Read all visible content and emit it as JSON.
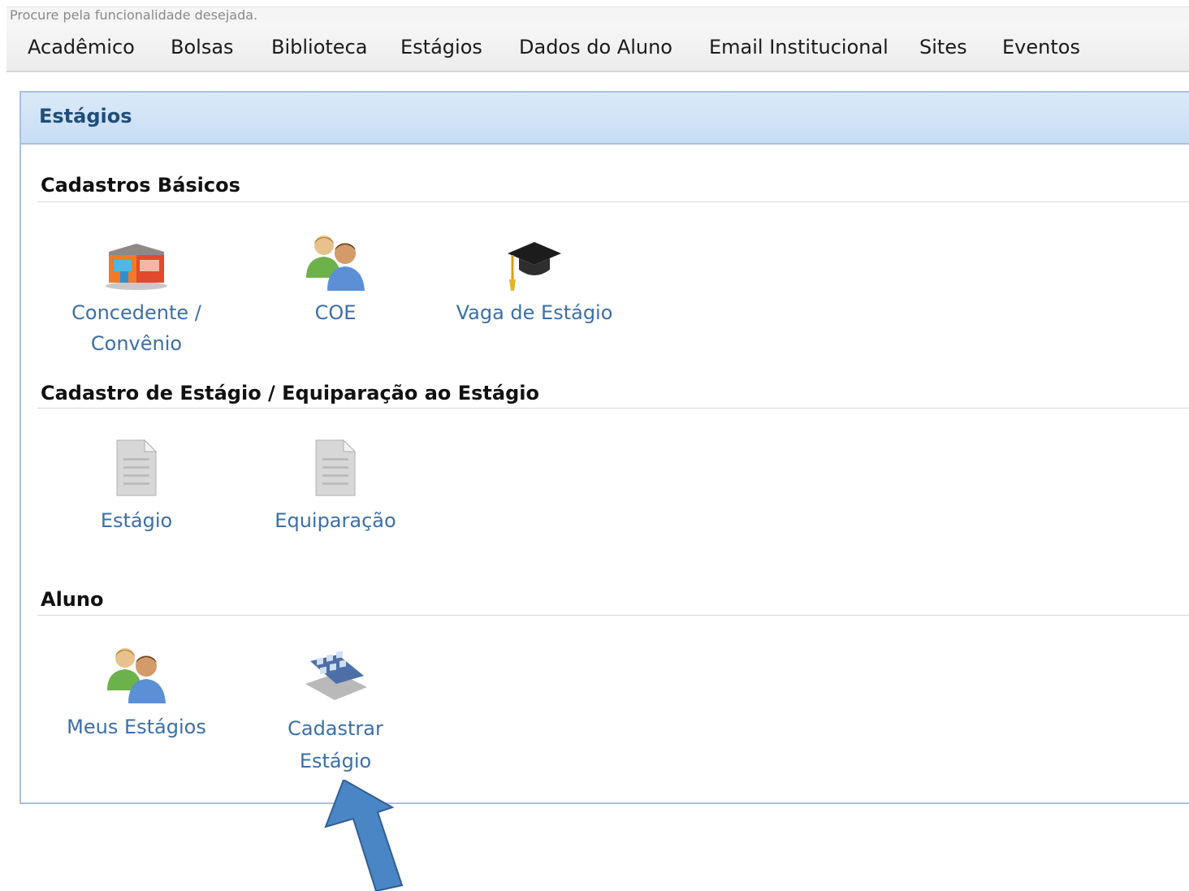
{
  "search": {
    "placeholder": "Procure pela funcionalidade desejada."
  },
  "menu": [
    "Acadêmico",
    "Bolsas",
    "Biblioteca",
    "Estágios",
    "Dados do Aluno",
    "Email Institucional",
    "Sites",
    "Eventos"
  ],
  "panel": {
    "title": "Estágios",
    "sections": {
      "basicos": {
        "title": "Cadastros Básicos",
        "items": [
          {
            "label_line1": "Concedente /",
            "label_line2": "Convênio",
            "icon": "building-icon"
          },
          {
            "label_line1": "COE",
            "icon": "users-icon"
          },
          {
            "label_line1": "Vaga de Estágio",
            "icon": "graduation-cap-icon"
          }
        ]
      },
      "cadastro": {
        "title": "Cadastro de Estágio / Equiparação ao Estágio",
        "items": [
          {
            "label_line1": "Estágio",
            "icon": "document-icon"
          },
          {
            "label_line1": "Equiparação",
            "icon": "document-icon"
          }
        ]
      },
      "aluno": {
        "title": "Aluno",
        "items": [
          {
            "label_line1": "Meus Estágios",
            "icon": "users-icon"
          },
          {
            "label_line1": "Cadastrar",
            "label_line2": "Estágio",
            "icon": "calendar-board-icon"
          }
        ]
      }
    }
  },
  "colors": {
    "link": "#3b6fa8",
    "header_bg": "#c7ddf4",
    "border": "#a8c0dd",
    "arrow": "#4a86c5"
  }
}
